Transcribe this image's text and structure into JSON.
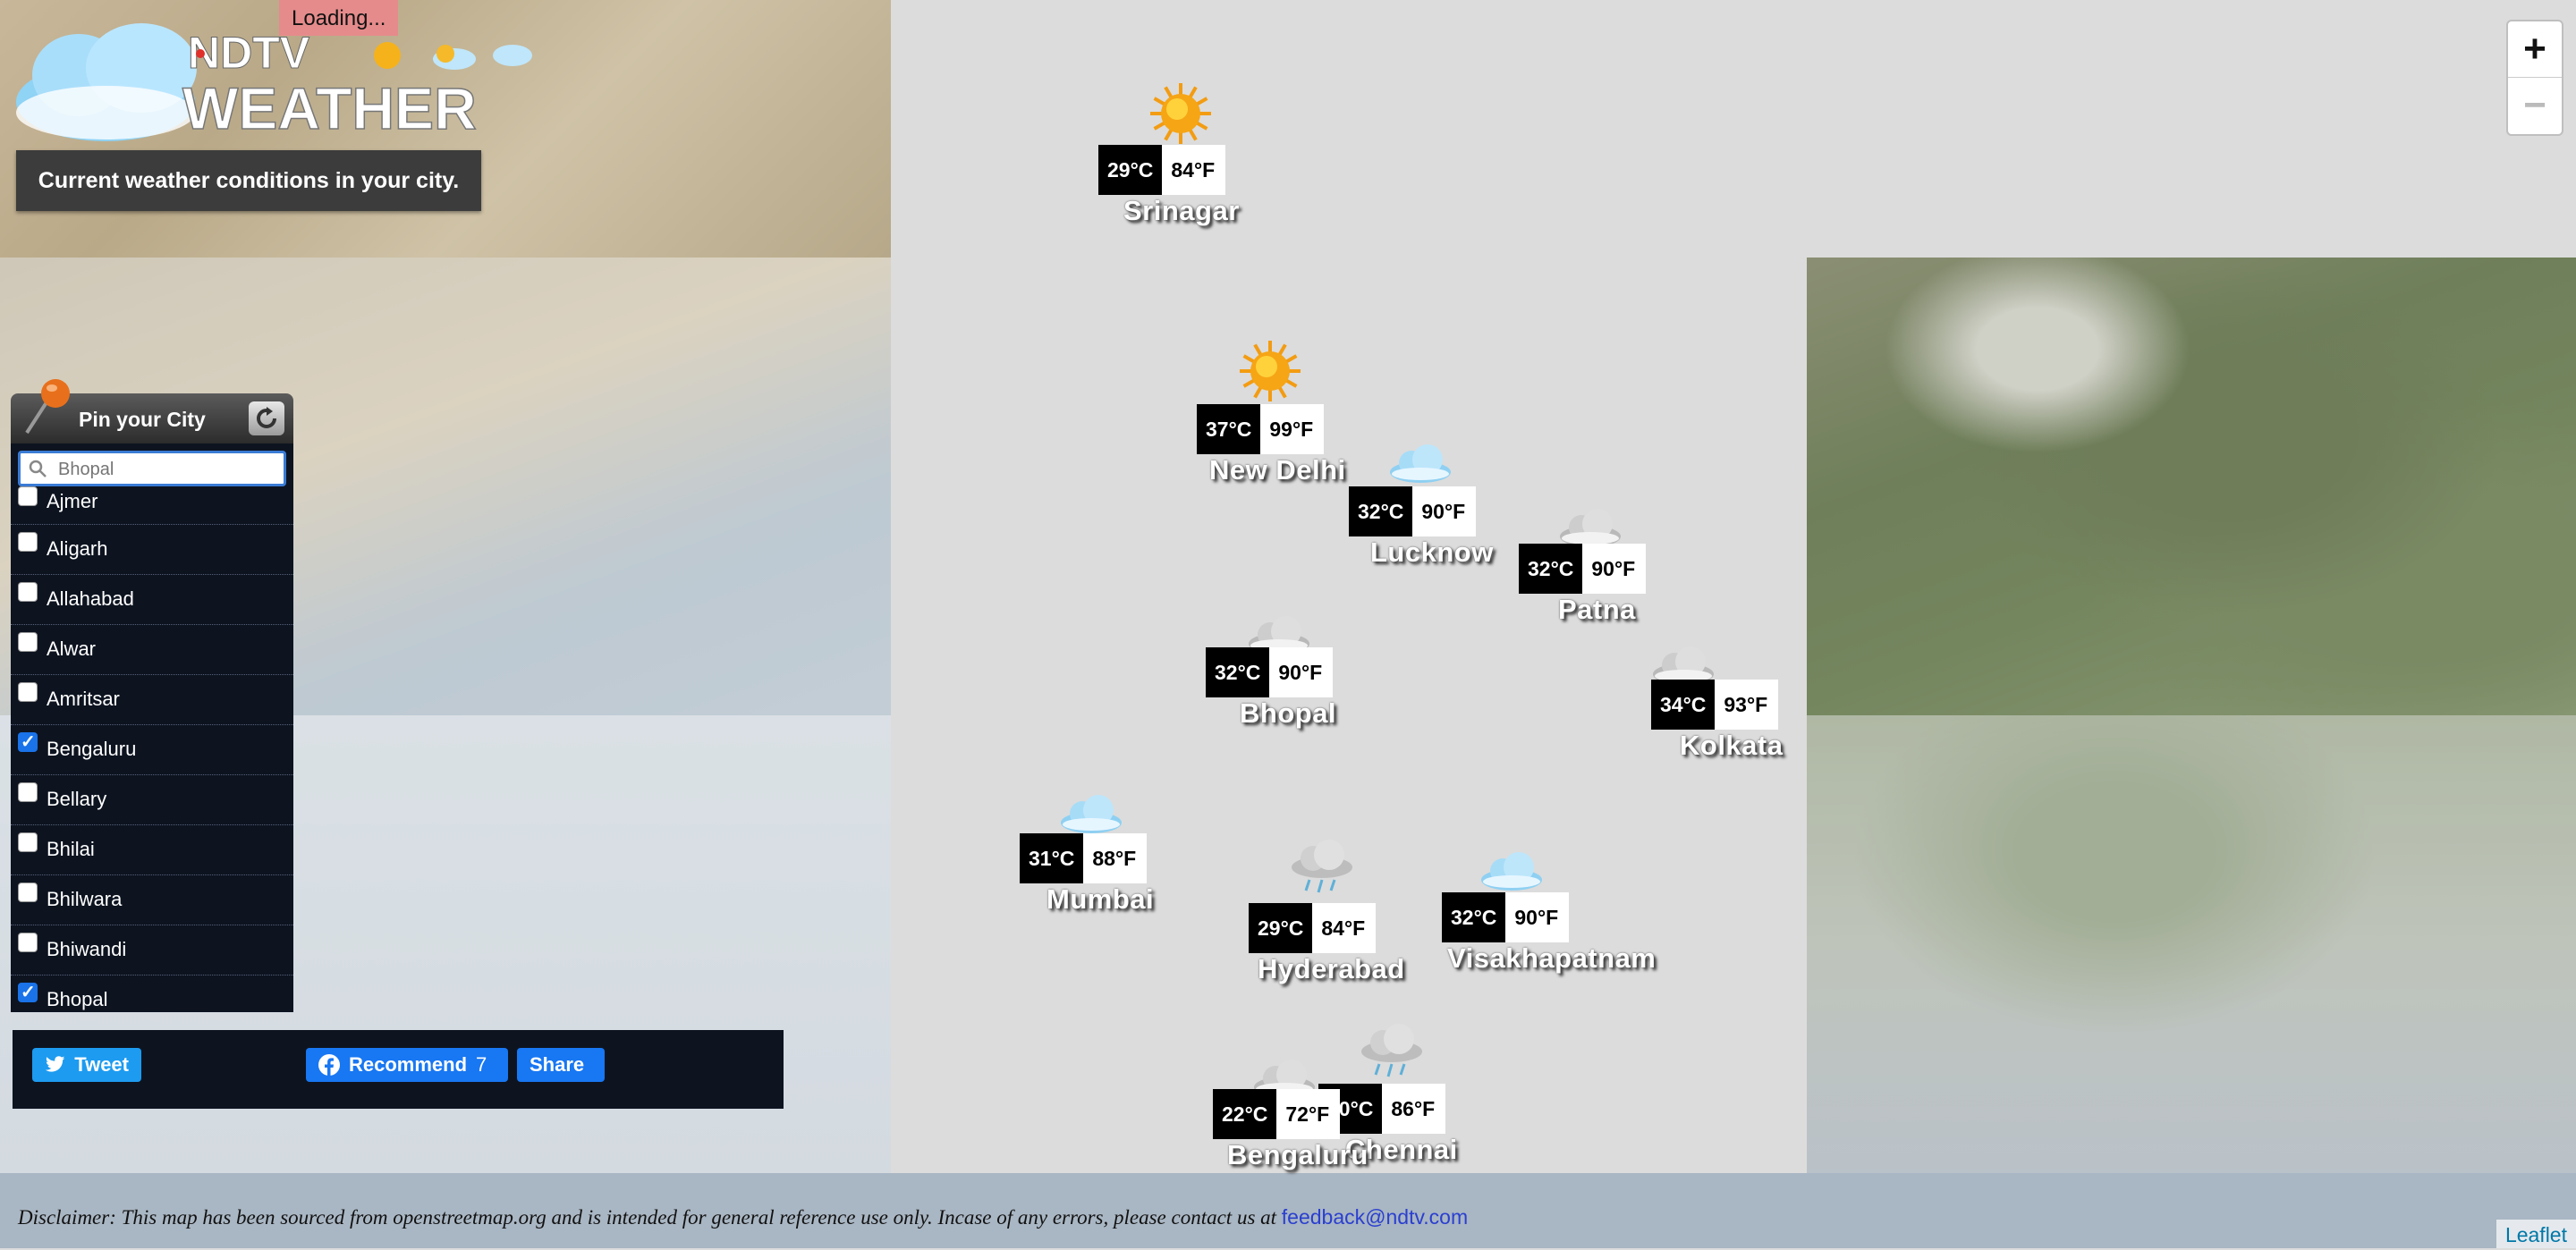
{
  "header": {
    "loading": "Loading...",
    "logo_brand": "NDTV",
    "logo_word": "WEATHER",
    "subtitle": "Current weather conditions in your city."
  },
  "zoom": {
    "in_label": "+",
    "out_label": "−"
  },
  "panel": {
    "title": "Pin your City",
    "search_placeholder": "Bhopal",
    "cities": [
      {
        "name": "Ajmer",
        "checked": false
      },
      {
        "name": "Aligarh",
        "checked": false
      },
      {
        "name": "Allahabad",
        "checked": false
      },
      {
        "name": "Alwar",
        "checked": false
      },
      {
        "name": "Amritsar",
        "checked": false
      },
      {
        "name": "Bengaluru",
        "checked": true
      },
      {
        "name": "Bellary",
        "checked": false
      },
      {
        "name": "Bhilai",
        "checked": false
      },
      {
        "name": "Bhilwara",
        "checked": false
      },
      {
        "name": "Bhiwandi",
        "checked": false
      },
      {
        "name": "Bhopal",
        "checked": true
      }
    ]
  },
  "share": {
    "tweet": "Tweet",
    "recommend": "Recommend",
    "recommend_count": "7",
    "share": "Share"
  },
  "markers": [
    {
      "city": "Srinagar",
      "c": "29°C",
      "f": "84°F",
      "icon": "sun-icon"
    },
    {
      "city": "New Delhi",
      "c": "37°C",
      "f": "99°F",
      "icon": "sun-icon"
    },
    {
      "city": "Lucknow",
      "c": "32°C",
      "f": "90°F",
      "icon": "cloud-icon"
    },
    {
      "city": "Patna",
      "c": "32°C",
      "f": "90°F",
      "icon": "grey-cloud-icon"
    },
    {
      "city": "Bhopal",
      "c": "32°C",
      "f": "90°F",
      "icon": "grey-cloud-icon"
    },
    {
      "city": "Kolkata",
      "c": "34°C",
      "f": "93°F",
      "icon": "grey-cloud-icon"
    },
    {
      "city": "Mumbai",
      "c": "31°C",
      "f": "88°F",
      "icon": "cloud-icon"
    },
    {
      "city": "Hyderabad",
      "c": "29°C",
      "f": "84°F",
      "icon": "rain-cloud-icon"
    },
    {
      "city": "Visakhapatnam",
      "c": "32°C",
      "f": "90°F",
      "icon": "cloud-icon"
    },
    {
      "city": "Chennai",
      "c": "30°C",
      "f": "86°F",
      "icon": "rain-cloud-icon"
    },
    {
      "city": "Bengaluru",
      "c": "22°C",
      "f": "72°F",
      "icon": "grey-cloud-icon"
    }
  ],
  "footer": {
    "disclaimer": "Disclaimer: This map has been sourced from openstreetmap.org and is intended for general reference use only. Incase of any errors, please contact us at",
    "email": "feedback@ndtv.com",
    "attribution": "Leaflet"
  }
}
